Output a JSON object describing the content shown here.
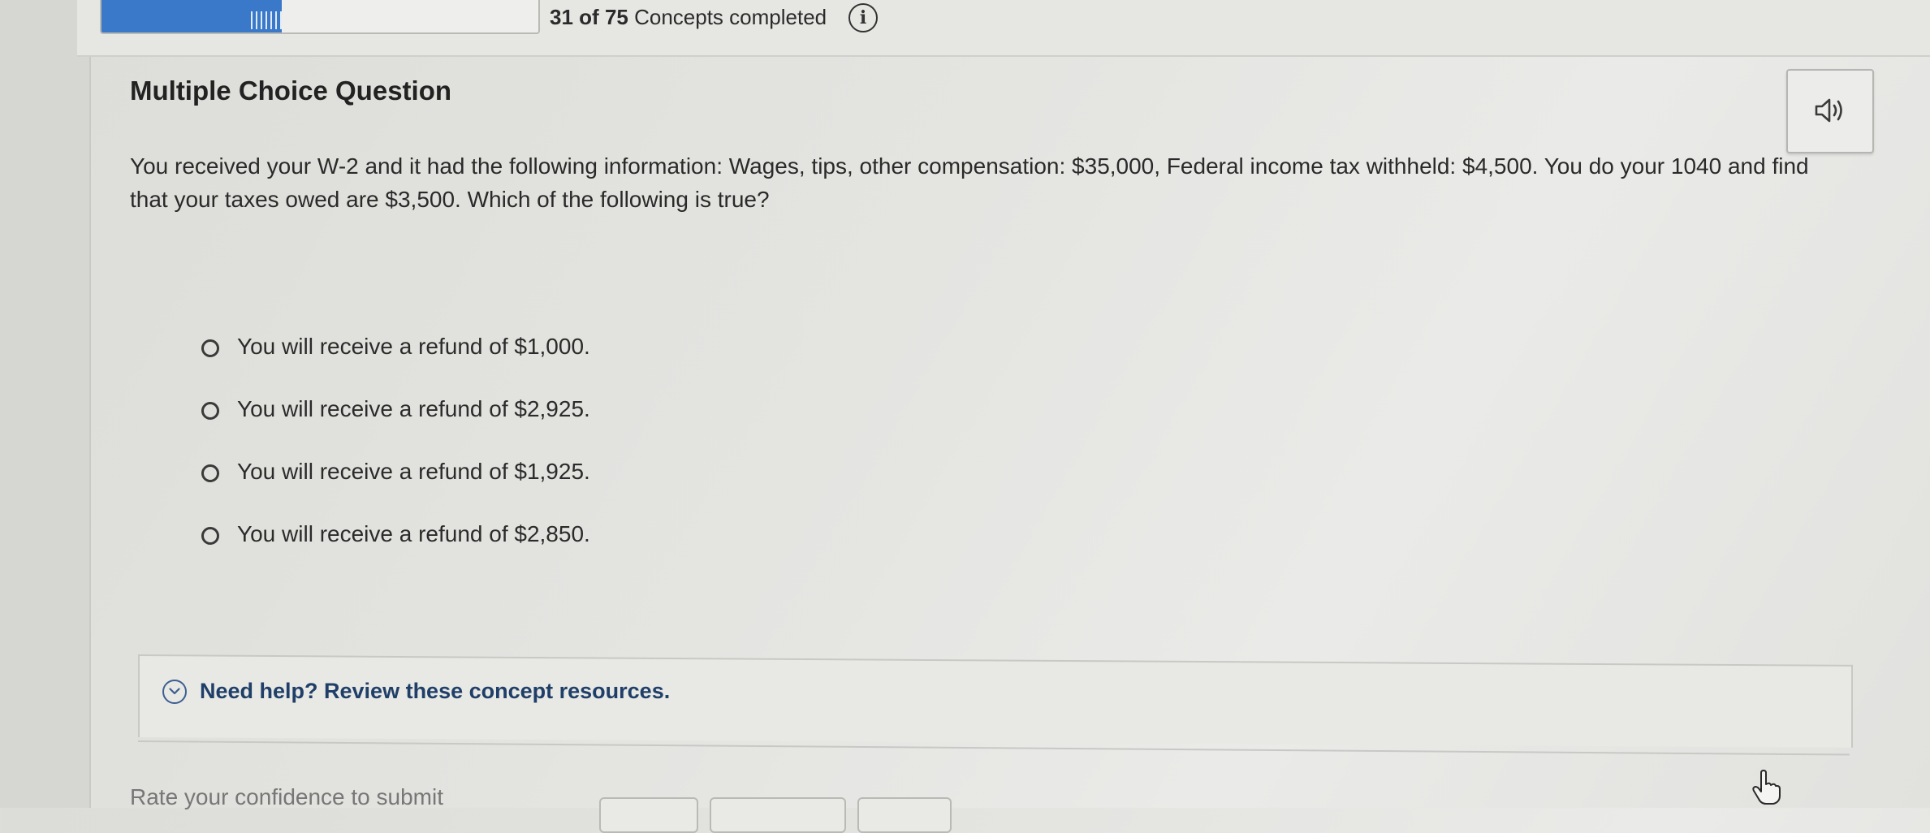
{
  "progress": {
    "completed": "31",
    "of_word": "of",
    "total": "75",
    "suffix": "Concepts completed",
    "fraction": 0.413
  },
  "question": {
    "type_label": "Multiple Choice Question",
    "text": "You received your W-2 and it had the following information: Wages, tips, other compensation: $35,000, Federal income tax withheld: $4,500. You do your 1040 and find that your taxes owed are $3,500. Which of the following is true?"
  },
  "options": [
    {
      "label": "You will receive a refund of $1,000."
    },
    {
      "label": "You will receive a refund of $2,925."
    },
    {
      "label": "You will receive a refund of $1,925."
    },
    {
      "label": "You will receive a refund of $2,850."
    }
  ],
  "help": {
    "label": "Need help? Review these concept resources."
  },
  "footer": {
    "confidence_prompt": "Rate your confidence to submit"
  },
  "icons": {
    "info": "info-icon",
    "check": "check-circle-icon",
    "audio": "speaker-icon",
    "help": "chevron-down-icon",
    "cursor": "hand-pointer-icon"
  },
  "colors": {
    "accent": "#3a78c9",
    "help_link": "#1f3f68"
  }
}
